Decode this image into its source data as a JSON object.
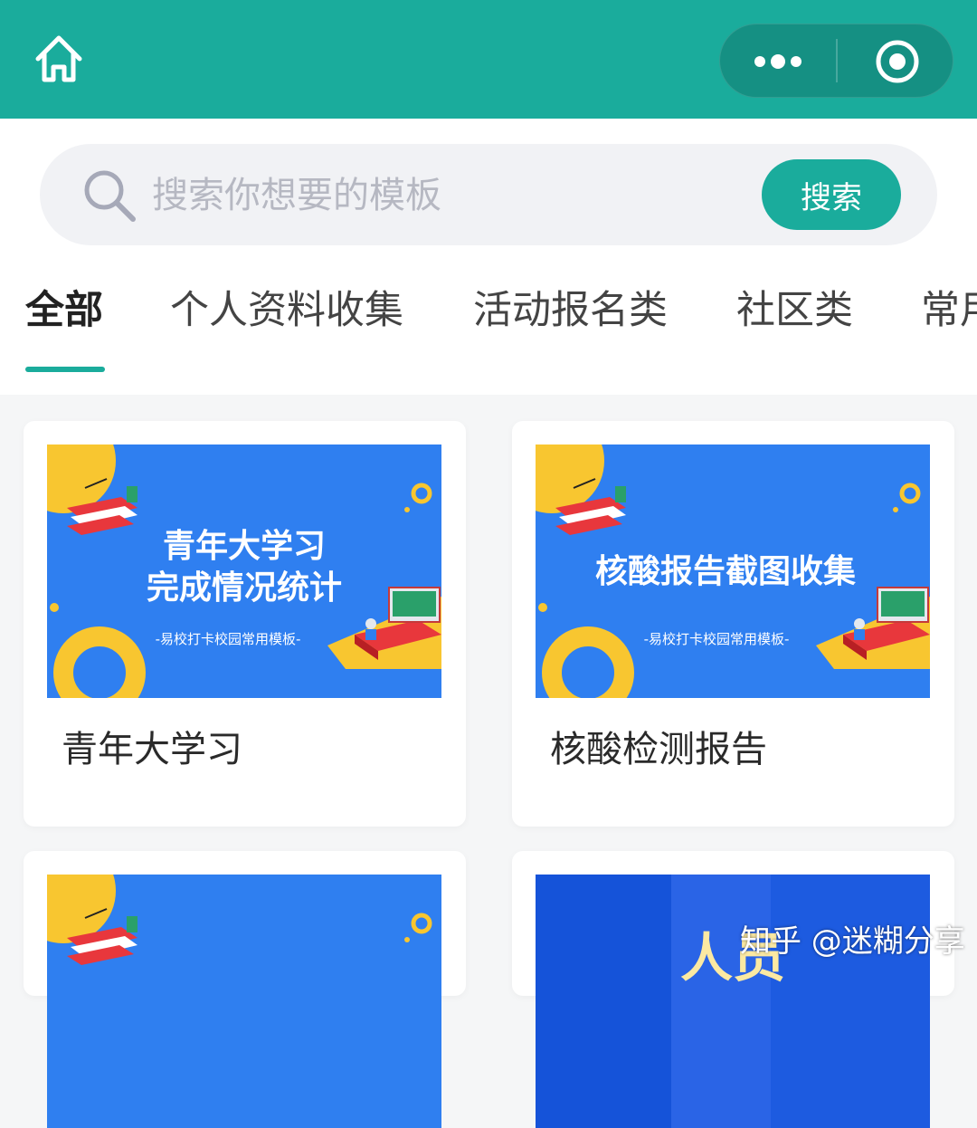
{
  "nav": {
    "home_icon": "home-icon",
    "more_icon": "more-dots-icon",
    "close_icon": "target-circle-icon"
  },
  "search": {
    "placeholder": "搜索你想要的模板",
    "value": "",
    "button_label": "搜索",
    "icon": "search-icon"
  },
  "tabs": [
    {
      "label": "全部",
      "active": true
    },
    {
      "label": "个人资料收集",
      "active": false
    },
    {
      "label": "活动报名类",
      "active": false
    },
    {
      "label": "社区类",
      "active": false
    },
    {
      "label": "常用",
      "active": false
    }
  ],
  "cards": [
    {
      "title": "青年大学习",
      "banner": {
        "line1": "青年大学习",
        "line2": "完成情况统计",
        "subtitle": "-易校打卡校园常用模板-"
      }
    },
    {
      "title": "核酸检测报告",
      "banner": {
        "line1": "核酸报告截图收集",
        "subtitle": "-易校打卡校园常用模板-"
      }
    },
    {
      "title": "",
      "banner": {}
    },
    {
      "title": "",
      "banner": {
        "partial_text": "人员"
      }
    }
  ],
  "watermark": "知乎 @迷糊分享",
  "colors": {
    "accent": "#1aac9c",
    "banner_blue": "#2f7ff0",
    "banner_yellow": "#f8c630",
    "banner_red": "#e8373c",
    "dark_blue": "#1553d9"
  }
}
